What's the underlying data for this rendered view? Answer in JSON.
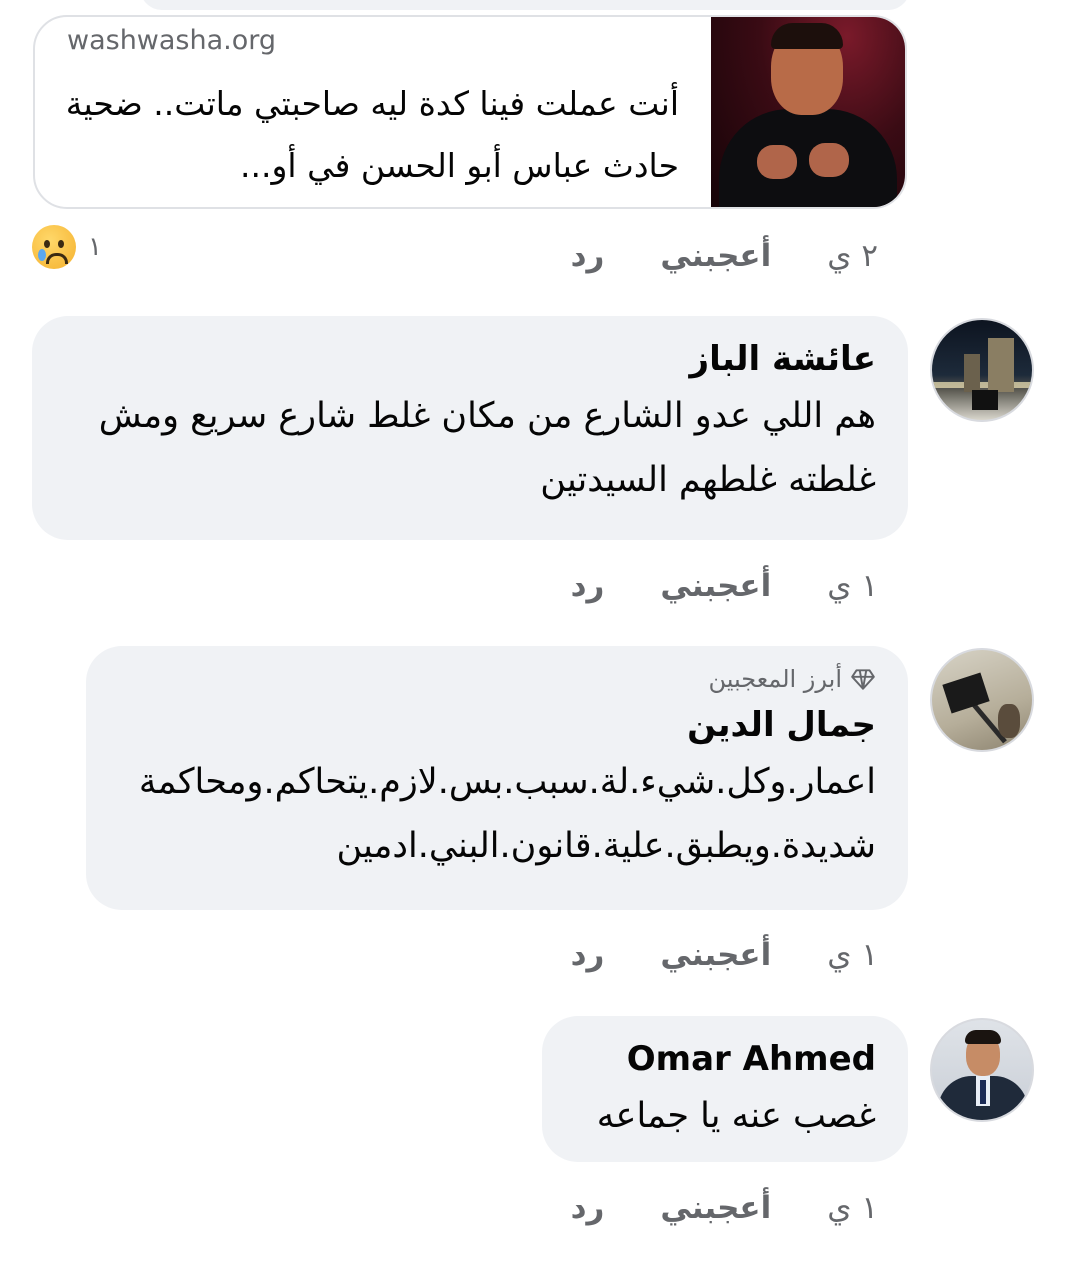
{
  "link_preview": {
    "domain": "washwasha.org",
    "title": "أنت عملت فينا كدة ليه صاحبتي ماتت.. ضحية حادث عباس أبو الحسن في أو...",
    "thumbnail_icon": "man-portrait-image",
    "actions": {
      "time": "٢ ي",
      "like_label": "أعجبني",
      "reply_label": "رد"
    },
    "reaction": {
      "icon": "sad-reaction-icon",
      "count": "١"
    }
  },
  "comments": [
    {
      "author": "عائشة الباز",
      "text": "هم اللي عدو الشارع من مكان غلط شارع سريع ومش غلطته غلطهم السيدتين",
      "time": "١ ي",
      "like_label": "أعجبني",
      "reply_label": "رد"
    },
    {
      "badge": "أبرز المعجبين",
      "badge_icon": "diamond-icon",
      "author": "جمال الدين",
      "text": "اعمار.وكل.شيء.لة.سبب.بس.لازم.يتحاكم.ومحاكمة شديدة.ويطبق.علية.قانون.البني.ادمين",
      "time": "١ ي",
      "like_label": "أعجبني",
      "reply_label": "رد"
    },
    {
      "author": "Omar Ahmed",
      "text": "غصب عنه يا جماعه",
      "time": "١ ي",
      "like_label": "أعجبني",
      "reply_label": "رد"
    }
  ],
  "colors": {
    "bubble_bg": "#f0f2f5",
    "secondary_text": "#65676b",
    "primary_text": "#050505"
  }
}
